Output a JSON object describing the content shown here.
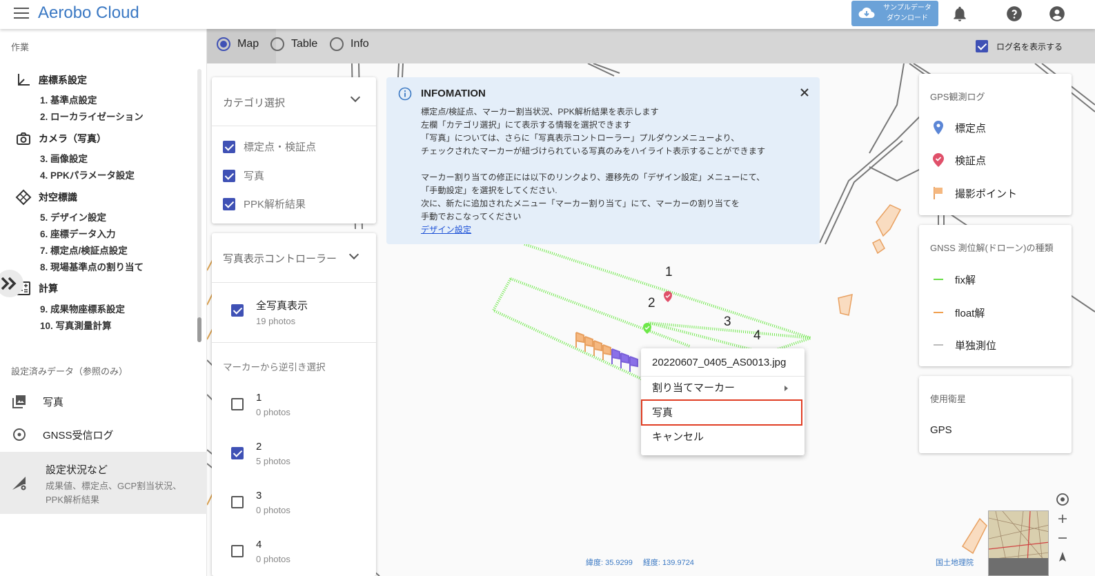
{
  "app": {
    "title": "Aerobo Cloud"
  },
  "header": {
    "download_line1": "サンプルデータ",
    "download_line2": "ダウンロード"
  },
  "sidebar": {
    "heading": "作業",
    "sections": [
      {
        "label": "座標系設定",
        "icon": "axis-icon",
        "items": [
          "1. 基準点設定",
          "2. ローカライゼーション"
        ]
      },
      {
        "label": "カメラ（写真）",
        "icon": "camera-icon",
        "items": [
          "3. 画像設定",
          "4. PPKパラメータ設定"
        ]
      },
      {
        "label": "対空標識",
        "icon": "target-marker-icon",
        "items": [
          "5. デザイン設定",
          "6. 座標データ入力",
          "7. 標定点/検証点設定",
          "8. 現場基準点の割り当て"
        ]
      },
      {
        "label": "計算",
        "icon": "calculator-icon",
        "items": [
          "9. 成果物座標系設定",
          "10. 写真測量計算"
        ]
      }
    ],
    "ref_heading": "設定済みデータ（参照のみ）",
    "ref_items": [
      "写真",
      "GNSS受信ログ"
    ],
    "active_item": {
      "label": "設定状況など",
      "desc1": "成果値、標定点、GCP割当状況、",
      "desc2": "PPK解析結果"
    }
  },
  "modes": {
    "options": [
      "Map",
      "Table",
      "Info"
    ],
    "selected": "Map",
    "show_log_names": "ログ名を表示する"
  },
  "category_panel": {
    "title": "カテゴリ選択",
    "items": [
      {
        "label": "標定点・検証点",
        "checked": true
      },
      {
        "label": "写真",
        "checked": true
      },
      {
        "label": "PPK解析結果",
        "checked": true
      }
    ]
  },
  "photo_controller": {
    "title": "写真表示コントローラー",
    "all_label": "全写真表示",
    "all_count": "19 photos",
    "reverse_heading": "マーカーから逆引き選択",
    "markers": [
      {
        "name": "1",
        "count": "0 photos",
        "checked": false
      },
      {
        "name": "2",
        "count": "5 photos",
        "checked": true
      },
      {
        "name": "3",
        "count": "0 photos",
        "checked": false
      },
      {
        "name": "4",
        "count": "0 photos",
        "checked": false
      }
    ]
  },
  "info": {
    "title": "INFOMATION",
    "lines": [
      "標定点/検証点、マーカー割当状況、PPK解析結果を表示します",
      "左欄「カテゴリ選択」にて表示する情報を選択できます",
      "「写真」については、さらに「写真表示コントローラー」プルダウンメニューより、",
      "チェックされたマーカーが紐づけられている写真のみをハイライト表示することができます",
      "",
      "マーカー割り当ての修正には以下のリンクより、遷移先の「デザイン設定」メニューにて、",
      "「手動設定」を選択をしてください.",
      "次に、新たに追加されたメニュー「マーカー割り当て」にて、マーカーの割り当てを",
      "手動でおこなってください"
    ],
    "link": "デザイン設定"
  },
  "context_menu": {
    "file": "20220607_0405_AS0013.jpg",
    "assign": "割り当てマーカー",
    "photo": "写真",
    "cancel": "キャンセル"
  },
  "map": {
    "flight_labels": [
      "1",
      "2",
      "3",
      "4"
    ],
    "lat_label": "緯度: 35.9299",
    "lon_label": "経度: 139.9724",
    "credit": "国土地理院"
  },
  "gps_log": {
    "title": "GPS観測ログ",
    "items": [
      {
        "label": "標定点",
        "icon": "blue-pin-icon"
      },
      {
        "label": "検証点",
        "icon": "red-pin-icon"
      },
      {
        "label": "撮影ポイント",
        "icon": "orange-flag-icon"
      }
    ]
  },
  "gnss_types": {
    "title": "GNSS 測位解(ドローン)の種類",
    "items": [
      {
        "label": "fix解",
        "color": "#66dd44"
      },
      {
        "label": "float解",
        "color": "#f0a050"
      },
      {
        "label": "単独測位",
        "color": "#bbbbbb"
      }
    ]
  },
  "satellites": {
    "title": "使用衛星",
    "value": "GPS"
  },
  "colors": {
    "brand": "#3a78c3",
    "accent": "#3f51b5",
    "highlight": "#e03c22"
  }
}
